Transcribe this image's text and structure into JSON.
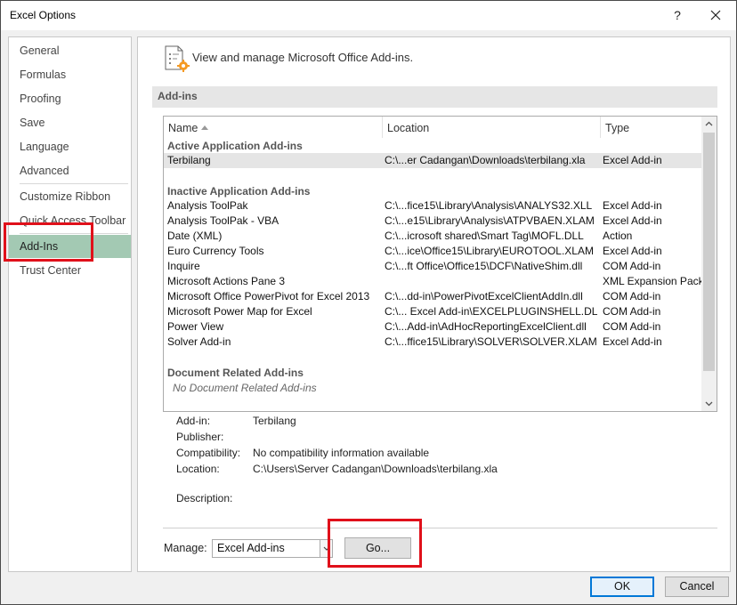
{
  "window": {
    "title": "Excel Options",
    "help_label": "?"
  },
  "sidebar": {
    "items": [
      {
        "label": "General"
      },
      {
        "label": "Formulas"
      },
      {
        "label": "Proofing"
      },
      {
        "label": "Save"
      },
      {
        "label": "Language"
      },
      {
        "label": "Advanced"
      },
      {
        "label": "Customize Ribbon"
      },
      {
        "label": "Quick Access Toolbar"
      },
      {
        "label": "Add-Ins",
        "selected": true
      },
      {
        "label": "Trust Center"
      }
    ]
  },
  "header": {
    "icon": "addins-gear-icon",
    "text": "View and manage Microsoft Office Add-ins."
  },
  "section": {
    "title": "Add-ins"
  },
  "table": {
    "columns": [
      "Name",
      "Location",
      "Type"
    ],
    "groups": [
      {
        "title": "Active Application Add-ins",
        "rows": [
          {
            "name": "Terbilang",
            "location": "C:\\...er Cadangan\\Downloads\\terbilang.xla",
            "type": "Excel Add-in",
            "selected": true
          }
        ]
      },
      {
        "title": "Inactive Application Add-ins",
        "rows": [
          {
            "name": "Analysis ToolPak",
            "location": "C:\\...fice15\\Library\\Analysis\\ANALYS32.XLL",
            "type": "Excel Add-in"
          },
          {
            "name": "Analysis ToolPak - VBA",
            "location": "C:\\...e15\\Library\\Analysis\\ATPVBAEN.XLAM",
            "type": "Excel Add-in"
          },
          {
            "name": "Date (XML)",
            "location": "C:\\...icrosoft shared\\Smart Tag\\MOFL.DLL",
            "type": "Action"
          },
          {
            "name": "Euro Currency Tools",
            "location": "C:\\...ice\\Office15\\Library\\EUROTOOL.XLAM",
            "type": "Excel Add-in"
          },
          {
            "name": "Inquire",
            "location": "C:\\...ft Office\\Office15\\DCF\\NativeShim.dll",
            "type": "COM Add-in"
          },
          {
            "name": "Microsoft Actions Pane 3",
            "location": "",
            "type": "XML Expansion Pack"
          },
          {
            "name": "Microsoft Office PowerPivot for Excel 2013",
            "location": "C:\\...dd-in\\PowerPivotExcelClientAddIn.dll",
            "type": "COM Add-in"
          },
          {
            "name": "Microsoft Power Map for Excel",
            "location": "C:\\... Excel Add-in\\EXCELPLUGINSHELL.DLL",
            "type": "COM Add-in"
          },
          {
            "name": "Power View",
            "location": "C:\\...Add-in\\AdHocReportingExcelClient.dll",
            "type": "COM Add-in"
          },
          {
            "name": "Solver Add-in",
            "location": "C:\\...ffice15\\Library\\SOLVER\\SOLVER.XLAM",
            "type": "Excel Add-in"
          }
        ]
      },
      {
        "title": "Document Related Add-ins",
        "empty_text": "No Document Related Add-ins"
      }
    ]
  },
  "details": {
    "addin_label": "Add-in:",
    "addin_value": "Terbilang",
    "publisher_label": "Publisher:",
    "publisher_value": "",
    "compat_label": "Compatibility:",
    "compat_value": "No compatibility information available",
    "location_label": "Location:",
    "location_value": "C:\\Users\\Server Cadangan\\Downloads\\terbilang.xla",
    "description_label": "Description:",
    "description_value": ""
  },
  "manage": {
    "label": "Manage:",
    "selected": "Excel Add-ins",
    "go_label": "Go..."
  },
  "footer": {
    "ok_label": "OK",
    "cancel_label": "Cancel"
  },
  "colors": {
    "selected_nav": "#a3c9b3",
    "highlight": "#e0101a",
    "ok_border": "#0078d7"
  }
}
